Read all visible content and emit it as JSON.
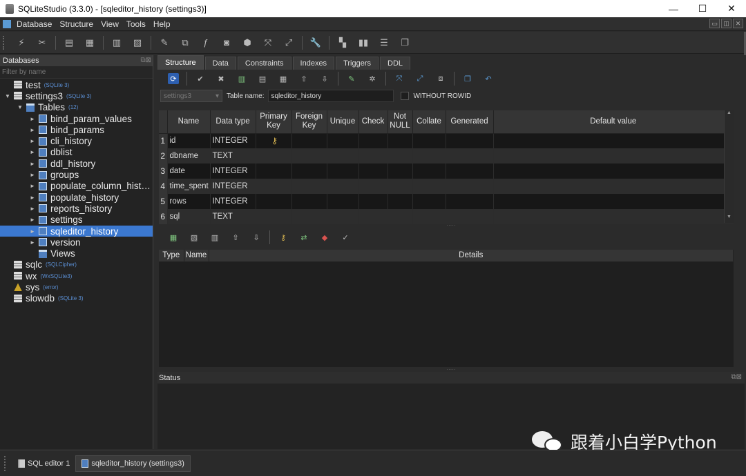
{
  "window": {
    "title": "SQLiteStudio (3.3.0) - [sqleditor_history (settings3)]",
    "controls": [
      "—",
      "☐",
      "✕"
    ]
  },
  "menu": [
    "Database",
    "Structure",
    "View",
    "Tools",
    "Help"
  ],
  "left_panel": {
    "title": "Databases",
    "filter_placeholder": "Filter by name",
    "tree": [
      {
        "label": "test",
        "tag": "(SQLite 3)",
        "kind": "db",
        "arrow": ""
      },
      {
        "label": "settings3",
        "tag": "(SQLite 3)",
        "kind": "db",
        "arrow": "▼"
      },
      {
        "label": "Tables",
        "tag": "(12)",
        "kind": "folder",
        "arrow": "▼"
      },
      {
        "label": "bind_param_values",
        "kind": "tbl",
        "arrow": "►"
      },
      {
        "label": "bind_params",
        "kind": "tbl",
        "arrow": "►"
      },
      {
        "label": "cli_history",
        "kind": "tbl",
        "arrow": "►"
      },
      {
        "label": "dblist",
        "kind": "tbl",
        "arrow": "►"
      },
      {
        "label": "ddl_history",
        "kind": "tbl",
        "arrow": "►"
      },
      {
        "label": "groups",
        "kind": "tbl",
        "arrow": "►"
      },
      {
        "label": "populate_column_hist…",
        "kind": "tbl",
        "arrow": "►"
      },
      {
        "label": "populate_history",
        "kind": "tbl",
        "arrow": "►"
      },
      {
        "label": "reports_history",
        "kind": "tbl",
        "arrow": "►"
      },
      {
        "label": "settings",
        "kind": "tbl",
        "arrow": "►"
      },
      {
        "label": "sqleditor_history",
        "kind": "tbl",
        "arrow": "►",
        "selected": true
      },
      {
        "label": "version",
        "kind": "tbl",
        "arrow": "►"
      },
      {
        "label": "Views",
        "kind": "folder",
        "arrow": ""
      },
      {
        "label": "sqlc",
        "tag": "(SQLCipher)",
        "kind": "db",
        "arrow": ""
      },
      {
        "label": "wx",
        "tag": "(WxSQLite3)",
        "kind": "db",
        "arrow": ""
      },
      {
        "label": "sys",
        "tag": "(error)",
        "kind": "warn",
        "arrow": ""
      },
      {
        "label": "slowdb",
        "tag": "(SQLite 3)",
        "kind": "db",
        "arrow": ""
      }
    ]
  },
  "tabs": [
    "Structure",
    "Data",
    "Constraints",
    "Indexes",
    "Triggers",
    "DDL"
  ],
  "table_name_row": {
    "db_select": "settings3",
    "label": "Table name:",
    "value": "sqleditor_history",
    "without_rowid": "WITHOUT ROWID"
  },
  "columns_grid": {
    "headers": [
      "",
      "Name",
      "Data type",
      "Primary Key",
      "Foreign Key",
      "Unique",
      "Check",
      "Not NULL",
      "Collate",
      "Generated",
      "Default value"
    ],
    "rows": [
      {
        "n": "1",
        "name": "id",
        "type": "INTEGER",
        "pk": true
      },
      {
        "n": "2",
        "name": "dbname",
        "type": "TEXT",
        "pk": false
      },
      {
        "n": "3",
        "name": "date",
        "type": "INTEGER",
        "pk": false
      },
      {
        "n": "4",
        "name": "time_spent",
        "type": "INTEGER",
        "pk": false
      },
      {
        "n": "5",
        "name": "rows",
        "type": "INTEGER",
        "pk": false
      },
      {
        "n": "6",
        "name": "sql",
        "type": "TEXT",
        "pk": false
      }
    ]
  },
  "constraints_grid": {
    "headers": [
      "Type",
      "Name",
      "Details"
    ]
  },
  "status_panel": {
    "title": "Status"
  },
  "watermark": "跟着小白学Python",
  "taskbar": [
    {
      "label": "SQL editor 1",
      "active": false
    },
    {
      "label": "sqleditor_history (settings3)",
      "active": true
    }
  ]
}
